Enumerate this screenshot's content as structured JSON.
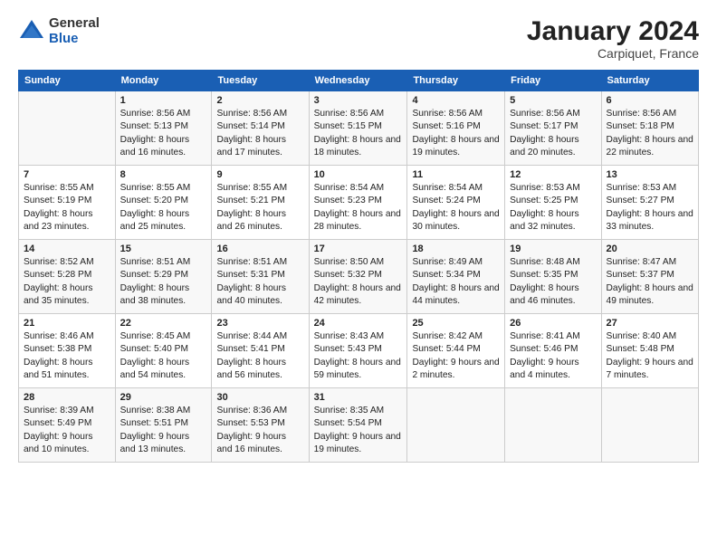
{
  "header": {
    "logo_general": "General",
    "logo_blue": "Blue",
    "month_year": "January 2024",
    "location": "Carpiquet, France"
  },
  "days_of_week": [
    "Sunday",
    "Monday",
    "Tuesday",
    "Wednesday",
    "Thursday",
    "Friday",
    "Saturday"
  ],
  "weeks": [
    [
      {
        "day": "",
        "sunrise": "",
        "sunset": "",
        "daylight": ""
      },
      {
        "day": "1",
        "sunrise": "Sunrise: 8:56 AM",
        "sunset": "Sunset: 5:13 PM",
        "daylight": "Daylight: 8 hours and 16 minutes."
      },
      {
        "day": "2",
        "sunrise": "Sunrise: 8:56 AM",
        "sunset": "Sunset: 5:14 PM",
        "daylight": "Daylight: 8 hours and 17 minutes."
      },
      {
        "day": "3",
        "sunrise": "Sunrise: 8:56 AM",
        "sunset": "Sunset: 5:15 PM",
        "daylight": "Daylight: 8 hours and 18 minutes."
      },
      {
        "day": "4",
        "sunrise": "Sunrise: 8:56 AM",
        "sunset": "Sunset: 5:16 PM",
        "daylight": "Daylight: 8 hours and 19 minutes."
      },
      {
        "day": "5",
        "sunrise": "Sunrise: 8:56 AM",
        "sunset": "Sunset: 5:17 PM",
        "daylight": "Daylight: 8 hours and 20 minutes."
      },
      {
        "day": "6",
        "sunrise": "Sunrise: 8:56 AM",
        "sunset": "Sunset: 5:18 PM",
        "daylight": "Daylight: 8 hours and 22 minutes."
      }
    ],
    [
      {
        "day": "7",
        "sunrise": "Sunrise: 8:55 AM",
        "sunset": "Sunset: 5:19 PM",
        "daylight": "Daylight: 8 hours and 23 minutes."
      },
      {
        "day": "8",
        "sunrise": "Sunrise: 8:55 AM",
        "sunset": "Sunset: 5:20 PM",
        "daylight": "Daylight: 8 hours and 25 minutes."
      },
      {
        "day": "9",
        "sunrise": "Sunrise: 8:55 AM",
        "sunset": "Sunset: 5:21 PM",
        "daylight": "Daylight: 8 hours and 26 minutes."
      },
      {
        "day": "10",
        "sunrise": "Sunrise: 8:54 AM",
        "sunset": "Sunset: 5:23 PM",
        "daylight": "Daylight: 8 hours and 28 minutes."
      },
      {
        "day": "11",
        "sunrise": "Sunrise: 8:54 AM",
        "sunset": "Sunset: 5:24 PM",
        "daylight": "Daylight: 8 hours and 30 minutes."
      },
      {
        "day": "12",
        "sunrise": "Sunrise: 8:53 AM",
        "sunset": "Sunset: 5:25 PM",
        "daylight": "Daylight: 8 hours and 32 minutes."
      },
      {
        "day": "13",
        "sunrise": "Sunrise: 8:53 AM",
        "sunset": "Sunset: 5:27 PM",
        "daylight": "Daylight: 8 hours and 33 minutes."
      }
    ],
    [
      {
        "day": "14",
        "sunrise": "Sunrise: 8:52 AM",
        "sunset": "Sunset: 5:28 PM",
        "daylight": "Daylight: 8 hours and 35 minutes."
      },
      {
        "day": "15",
        "sunrise": "Sunrise: 8:51 AM",
        "sunset": "Sunset: 5:29 PM",
        "daylight": "Daylight: 8 hours and 38 minutes."
      },
      {
        "day": "16",
        "sunrise": "Sunrise: 8:51 AM",
        "sunset": "Sunset: 5:31 PM",
        "daylight": "Daylight: 8 hours and 40 minutes."
      },
      {
        "day": "17",
        "sunrise": "Sunrise: 8:50 AM",
        "sunset": "Sunset: 5:32 PM",
        "daylight": "Daylight: 8 hours and 42 minutes."
      },
      {
        "day": "18",
        "sunrise": "Sunrise: 8:49 AM",
        "sunset": "Sunset: 5:34 PM",
        "daylight": "Daylight: 8 hours and 44 minutes."
      },
      {
        "day": "19",
        "sunrise": "Sunrise: 8:48 AM",
        "sunset": "Sunset: 5:35 PM",
        "daylight": "Daylight: 8 hours and 46 minutes."
      },
      {
        "day": "20",
        "sunrise": "Sunrise: 8:47 AM",
        "sunset": "Sunset: 5:37 PM",
        "daylight": "Daylight: 8 hours and 49 minutes."
      }
    ],
    [
      {
        "day": "21",
        "sunrise": "Sunrise: 8:46 AM",
        "sunset": "Sunset: 5:38 PM",
        "daylight": "Daylight: 8 hours and 51 minutes."
      },
      {
        "day": "22",
        "sunrise": "Sunrise: 8:45 AM",
        "sunset": "Sunset: 5:40 PM",
        "daylight": "Daylight: 8 hours and 54 minutes."
      },
      {
        "day": "23",
        "sunrise": "Sunrise: 8:44 AM",
        "sunset": "Sunset: 5:41 PM",
        "daylight": "Daylight: 8 hours and 56 minutes."
      },
      {
        "day": "24",
        "sunrise": "Sunrise: 8:43 AM",
        "sunset": "Sunset: 5:43 PM",
        "daylight": "Daylight: 8 hours and 59 minutes."
      },
      {
        "day": "25",
        "sunrise": "Sunrise: 8:42 AM",
        "sunset": "Sunset: 5:44 PM",
        "daylight": "Daylight: 9 hours and 2 minutes."
      },
      {
        "day": "26",
        "sunrise": "Sunrise: 8:41 AM",
        "sunset": "Sunset: 5:46 PM",
        "daylight": "Daylight: 9 hours and 4 minutes."
      },
      {
        "day": "27",
        "sunrise": "Sunrise: 8:40 AM",
        "sunset": "Sunset: 5:48 PM",
        "daylight": "Daylight: 9 hours and 7 minutes."
      }
    ],
    [
      {
        "day": "28",
        "sunrise": "Sunrise: 8:39 AM",
        "sunset": "Sunset: 5:49 PM",
        "daylight": "Daylight: 9 hours and 10 minutes."
      },
      {
        "day": "29",
        "sunrise": "Sunrise: 8:38 AM",
        "sunset": "Sunset: 5:51 PM",
        "daylight": "Daylight: 9 hours and 13 minutes."
      },
      {
        "day": "30",
        "sunrise": "Sunrise: 8:36 AM",
        "sunset": "Sunset: 5:53 PM",
        "daylight": "Daylight: 9 hours and 16 minutes."
      },
      {
        "day": "31",
        "sunrise": "Sunrise: 8:35 AM",
        "sunset": "Sunset: 5:54 PM",
        "daylight": "Daylight: 9 hours and 19 minutes."
      },
      {
        "day": "",
        "sunrise": "",
        "sunset": "",
        "daylight": ""
      },
      {
        "day": "",
        "sunrise": "",
        "sunset": "",
        "daylight": ""
      },
      {
        "day": "",
        "sunrise": "",
        "sunset": "",
        "daylight": ""
      }
    ]
  ]
}
